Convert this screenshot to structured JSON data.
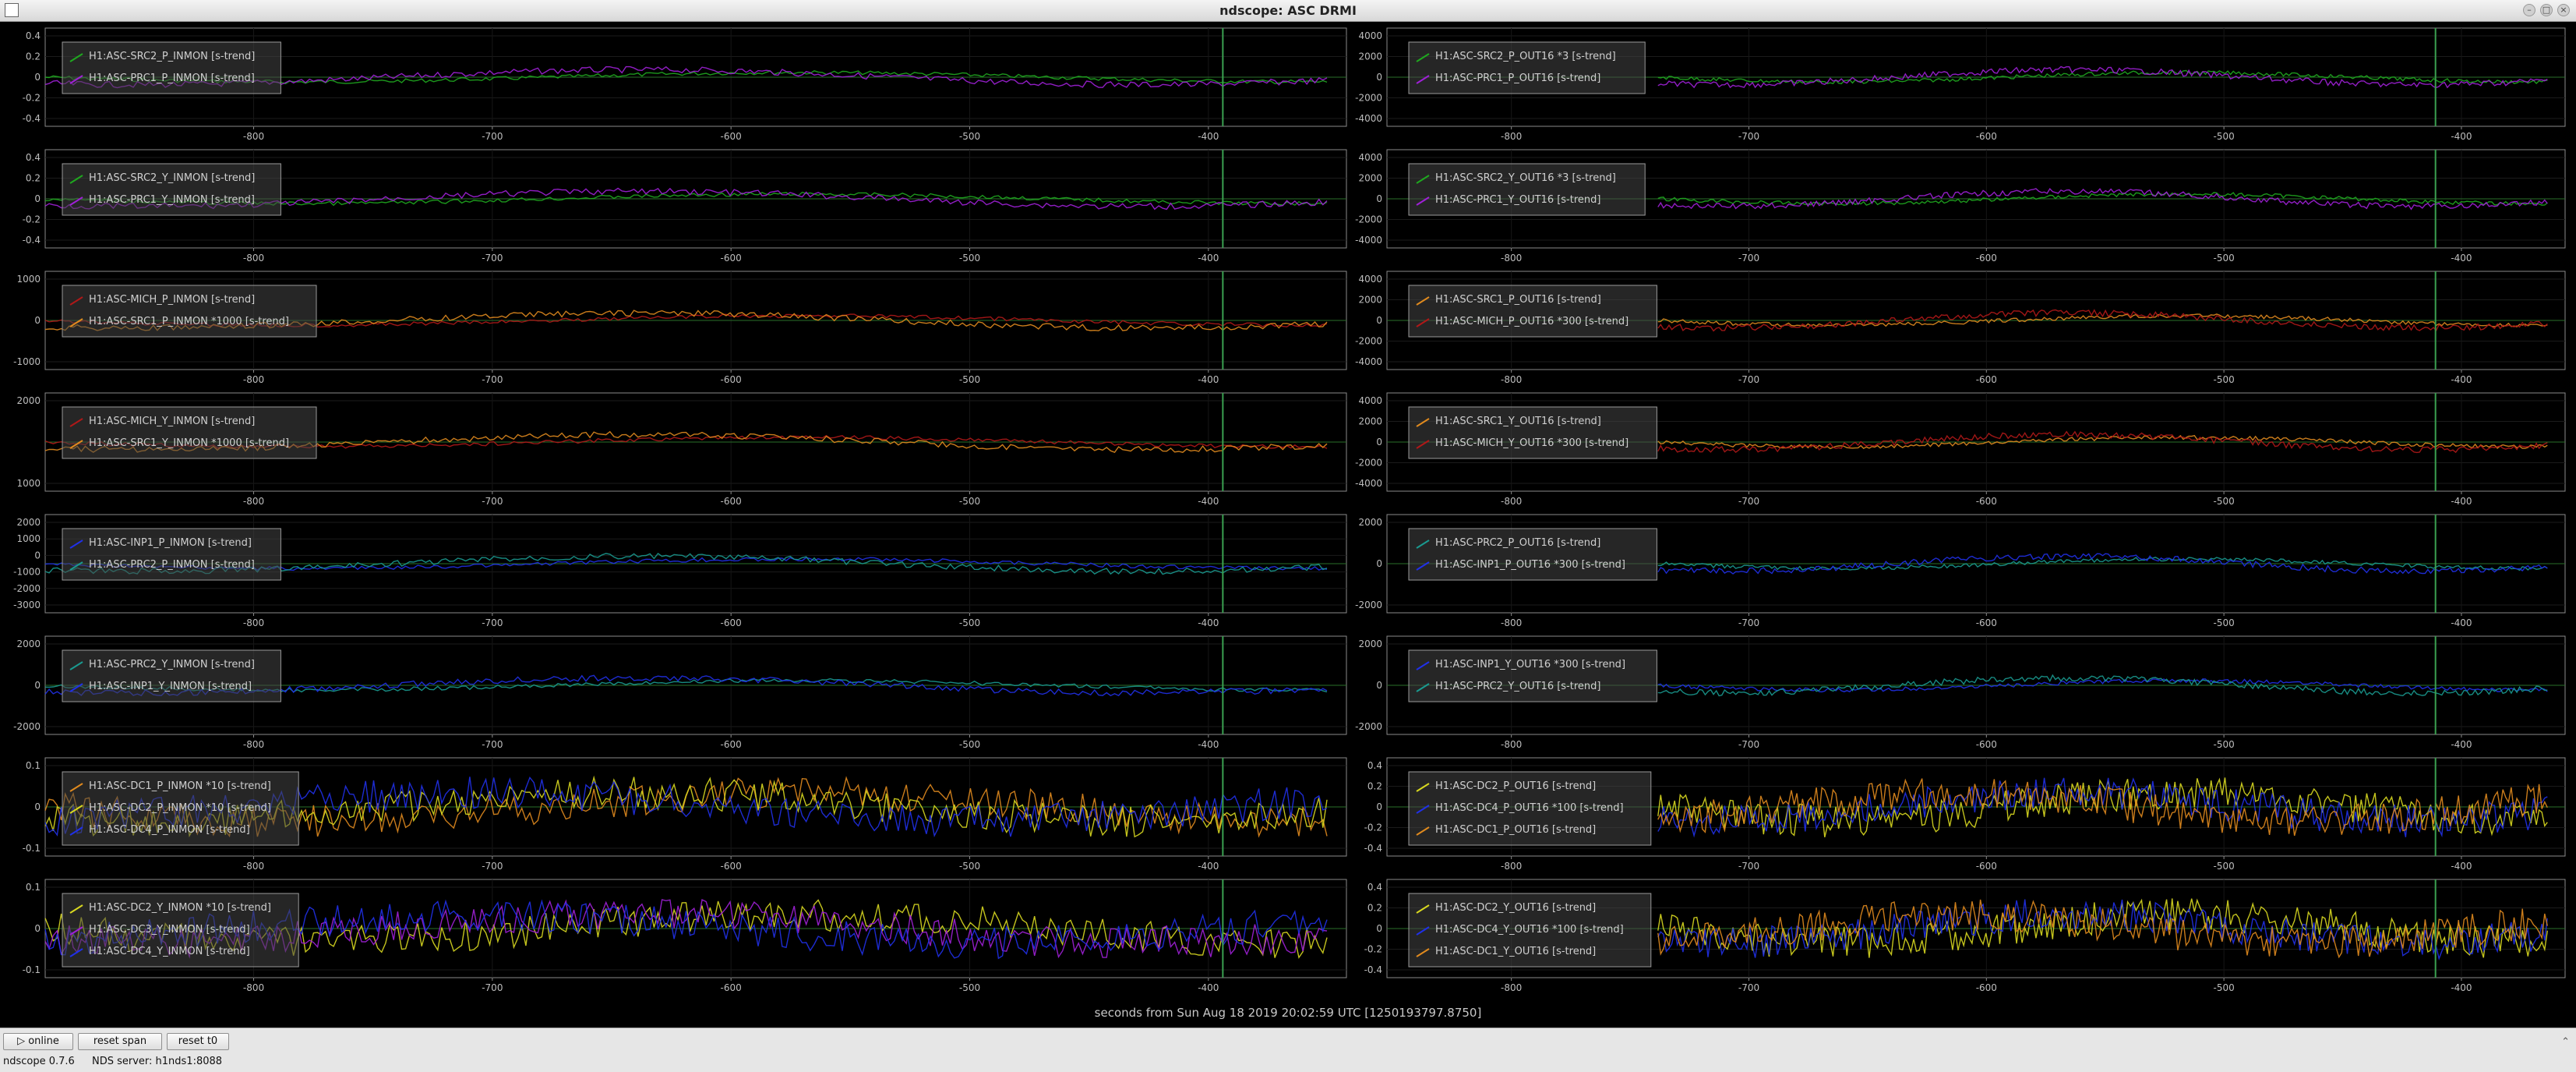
{
  "window": {
    "title": "ndscope: ASC DRMI"
  },
  "xaxis": {
    "label": "seconds from Sun Aug 18 2019 20:02:59 UTC [1250193797.8750]",
    "ticks_left": [
      "-800",
      "-700",
      "-600",
      "-500",
      "-400"
    ],
    "ticks_right": [
      "-800",
      "-700",
      "-600",
      "-500",
      "-400"
    ]
  },
  "colors": {
    "green": "#1fa81f",
    "purple": "#a020d8",
    "orange": "#e08a1e",
    "red": "#b01818",
    "blue": "#2030e8",
    "teal": "#1a9a90",
    "yellow": "#d8d820",
    "cursor": "#3aa050"
  },
  "panels": [
    {
      "id": "p1l",
      "yticks": [
        "0.4",
        "0.2",
        "0",
        "-0.2",
        "-0.4"
      ],
      "legend": [
        {
          "label": "H1:ASC-SRC2_P_INMON [s-trend]",
          "color": "green"
        },
        {
          "label": "H1:ASC-PRC1_P_INMON [s-trend]",
          "color": "purple"
        }
      ]
    },
    {
      "id": "p1r",
      "yticks": [
        "4000",
        "2000",
        "0",
        "-2000",
        "-4000"
      ],
      "legend": [
        {
          "label": "H1:ASC-SRC2_P_OUT16 *3 [s-trend]",
          "color": "green"
        },
        {
          "label": "H1:ASC-PRC1_P_OUT16 [s-trend]",
          "color": "purple"
        }
      ]
    },
    {
      "id": "p2l",
      "yticks": [
        "0.4",
        "0.2",
        "0",
        "-0.2",
        "-0.4"
      ],
      "legend": [
        {
          "label": "H1:ASC-SRC2_Y_INMON [s-trend]",
          "color": "green"
        },
        {
          "label": "H1:ASC-PRC1_Y_INMON [s-trend]",
          "color": "purple"
        }
      ]
    },
    {
      "id": "p2r",
      "yticks": [
        "4000",
        "2000",
        "0",
        "-2000",
        "-4000"
      ],
      "legend": [
        {
          "label": "H1:ASC-SRC2_Y_OUT16 *3 [s-trend]",
          "color": "green"
        },
        {
          "label": "H1:ASC-PRC1_Y_OUT16 [s-trend]",
          "color": "purple"
        }
      ]
    },
    {
      "id": "p3l",
      "yticks": [
        "1000",
        "0",
        "-1000"
      ],
      "legend": [
        {
          "label": "H1:ASC-MICH_P_INMON [s-trend]",
          "color": "red"
        },
        {
          "label": "H1:ASC-SRC1_P_INMON *1000 [s-trend]",
          "color": "orange"
        }
      ]
    },
    {
      "id": "p3r",
      "yticks": [
        "4000",
        "2000",
        "0",
        "-2000",
        "-4000"
      ],
      "legend": [
        {
          "label": "H1:ASC-SRC1_P_OUT16 [s-trend]",
          "color": "orange"
        },
        {
          "label": "H1:ASC-MICH_P_OUT16 *300 [s-trend]",
          "color": "red"
        }
      ]
    },
    {
      "id": "p4l",
      "yticks": [
        "2000",
        "1000"
      ],
      "legend": [
        {
          "label": "H1:ASC-MICH_Y_INMON [s-trend]",
          "color": "red"
        },
        {
          "label": "H1:ASC-SRC1_Y_INMON *1000 [s-trend]",
          "color": "orange"
        }
      ]
    },
    {
      "id": "p4r",
      "yticks": [
        "4000",
        "2000",
        "0",
        "-2000",
        "-4000"
      ],
      "legend": [
        {
          "label": "H1:ASC-SRC1_Y_OUT16 [s-trend]",
          "color": "orange"
        },
        {
          "label": "H1:ASC-MICH_Y_OUT16 *300 [s-trend]",
          "color": "red"
        }
      ]
    },
    {
      "id": "p5l",
      "yticks": [
        "2000",
        "1000",
        "0",
        "-1000",
        "-2000",
        "-3000"
      ],
      "legend": [
        {
          "label": "H1:ASC-INP1_P_INMON [s-trend]",
          "color": "blue"
        },
        {
          "label": "H1:ASC-PRC2_P_INMON [s-trend]",
          "color": "teal"
        }
      ]
    },
    {
      "id": "p5r",
      "yticks": [
        "2000",
        "0",
        "-2000"
      ],
      "legend": [
        {
          "label": "H1:ASC-PRC2_P_OUT16 [s-trend]",
          "color": "teal"
        },
        {
          "label": "H1:ASC-INP1_P_OUT16 *300 [s-trend]",
          "color": "blue"
        }
      ]
    },
    {
      "id": "p6l",
      "yticks": [
        "2000",
        "0",
        "-2000"
      ],
      "legend": [
        {
          "label": "H1:ASC-PRC2_Y_INMON [s-trend]",
          "color": "teal"
        },
        {
          "label": "H1:ASC-INP1_Y_INMON [s-trend]",
          "color": "blue"
        }
      ]
    },
    {
      "id": "p6r",
      "yticks": [
        "2000",
        "0",
        "-2000"
      ],
      "legend": [
        {
          "label": "H1:ASC-INP1_Y_OUT16 *300 [s-trend]",
          "color": "blue"
        },
        {
          "label": "H1:ASC-PRC2_Y_OUT16 [s-trend]",
          "color": "teal"
        }
      ]
    },
    {
      "id": "p7l",
      "yticks": [
        "0.1",
        "0",
        "-0.1"
      ],
      "legend": [
        {
          "label": "H1:ASC-DC1_P_INMON *10 [s-trend]",
          "color": "orange"
        },
        {
          "label": "H1:ASC-DC2_P_INMON *10 [s-trend]",
          "color": "yellow"
        },
        {
          "label": "H1:ASC-DC4_P_INMON [s-trend]",
          "color": "blue"
        }
      ]
    },
    {
      "id": "p7r",
      "yticks": [
        "0.4",
        "0.2",
        "0",
        "-0.2",
        "-0.4"
      ],
      "legend": [
        {
          "label": "H1:ASC-DC2_P_OUT16 [s-trend]",
          "color": "yellow"
        },
        {
          "label": "H1:ASC-DC4_P_OUT16 *100 [s-trend]",
          "color": "blue"
        },
        {
          "label": "H1:ASC-DC1_P_OUT16 [s-trend]",
          "color": "orange"
        }
      ]
    },
    {
      "id": "p8l",
      "yticks": [
        "0.1",
        "0",
        "-0.1"
      ],
      "legend": [
        {
          "label": "H1:ASC-DC2_Y_INMON *10 [s-trend]",
          "color": "yellow"
        },
        {
          "label": "H1:ASC-DC3_Y_INMON [s-trend]",
          "color": "purple"
        },
        {
          "label": "H1:ASC-DC4_Y_INMON [s-trend]",
          "color": "blue"
        }
      ]
    },
    {
      "id": "p8r",
      "yticks": [
        "0.4",
        "0.2",
        "0",
        "-0.2",
        "-0.4"
      ],
      "legend": [
        {
          "label": "H1:ASC-DC2_Y_OUT16 [s-trend]",
          "color": "yellow"
        },
        {
          "label": "H1:ASC-DC4_Y_OUT16 *100 [s-trend]",
          "color": "blue"
        },
        {
          "label": "H1:ASC-DC1_Y_OUT16 [s-trend]",
          "color": "orange"
        }
      ]
    }
  ],
  "toolbar": {
    "online_label": "▷ online",
    "reset_span_label": "reset span",
    "reset_t0_label": "reset t0"
  },
  "status": {
    "version": "ndscope 0.7.6",
    "server": "NDS server: h1nds1:8088"
  }
}
